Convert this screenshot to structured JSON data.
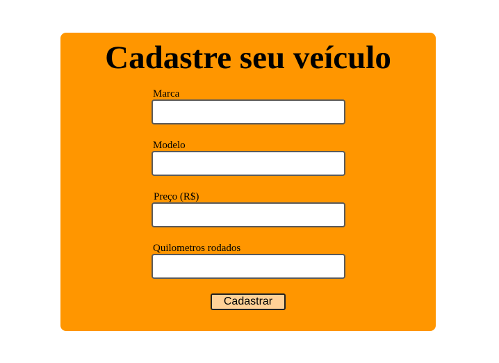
{
  "form": {
    "title": "Cadastre seu veículo",
    "fields": [
      {
        "label": "Marca",
        "value": ""
      },
      {
        "label": "Modelo",
        "value": ""
      },
      {
        "label": "Preço (R$)",
        "value": ""
      },
      {
        "label": "Quilometros rodados",
        "value": ""
      }
    ],
    "submit_label": "Cadastrar"
  },
  "colors": {
    "card_background": "#ff9600",
    "button_background": "#ffd197",
    "page_background": "#ffffff"
  }
}
